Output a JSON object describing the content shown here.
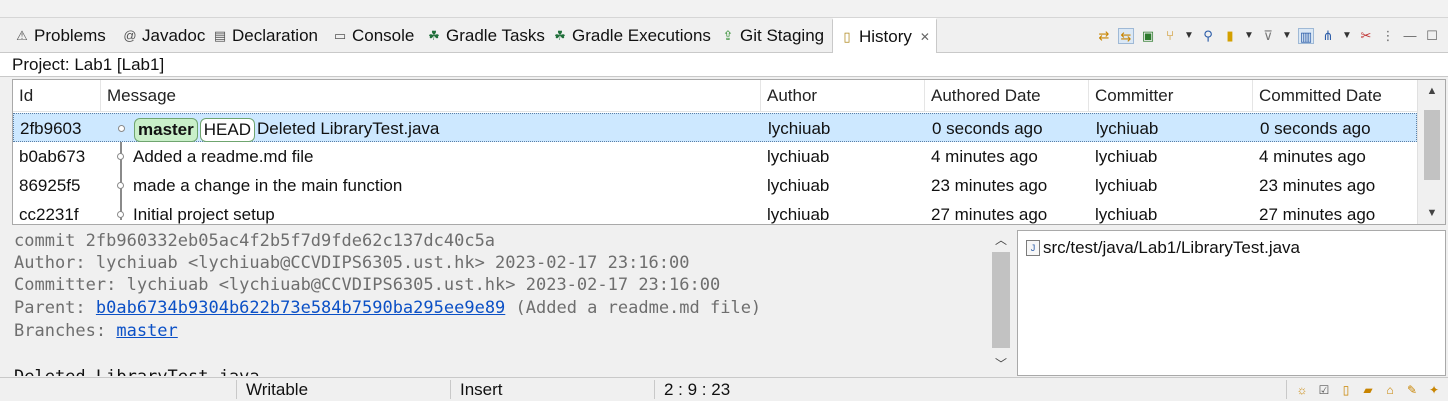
{
  "tabs": [
    {
      "label": "Problems",
      "icon": "problems-icon",
      "glyph": "⚠"
    },
    {
      "label": "Javadoc",
      "icon": "javadoc-icon",
      "glyph": "@"
    },
    {
      "label": "Declaration",
      "icon": "declaration-icon",
      "glyph": "▤"
    },
    {
      "label": "Console",
      "icon": "console-icon",
      "glyph": "▭"
    },
    {
      "label": "Gradle Tasks",
      "icon": "gradle-icon",
      "glyph": "☘"
    },
    {
      "label": "Gradle Executions",
      "icon": "gradle-icon",
      "glyph": "☘"
    },
    {
      "label": "Git Staging",
      "icon": "git-staging-icon",
      "glyph": "⇪"
    },
    {
      "label": "History",
      "icon": "history-icon",
      "glyph": "▯",
      "active": true,
      "close": "✕"
    }
  ],
  "project_line": "Project: Lab1 [Lab1]",
  "table": {
    "headers": [
      "Id",
      "Message",
      "Author",
      "Authored Date",
      "Committer",
      "Committed Date"
    ],
    "rows": [
      {
        "id": "2fb9603",
        "refs": [
          "master",
          "HEAD"
        ],
        "message": "Deleted LibraryTest.java",
        "author": "lychiuab",
        "authored": "0 seconds ago",
        "committer": "lychiuab",
        "committed": "0 seconds ago",
        "selected": true
      },
      {
        "id": "b0ab673",
        "refs": [],
        "message": "Added a readme.md file",
        "author": "lychiuab",
        "authored": "4 minutes ago",
        "committer": "lychiuab",
        "committed": "4 minutes ago"
      },
      {
        "id": "86925f5",
        "refs": [],
        "message": "made a change in the main function",
        "author": "lychiuab",
        "authored": "23 minutes ago",
        "committer": "lychiuab",
        "committed": "23 minutes ago"
      },
      {
        "id": "cc2231f",
        "refs": [],
        "message": "Initial project setup",
        "author": "lychiuab",
        "authored": "27 minutes ago",
        "committer": "lychiuab",
        "committed": "27 minutes ago"
      }
    ]
  },
  "details": {
    "commit_line": "commit 2fb960332eb05ac4f2b5f7d9fde62c137dc40c5a",
    "author_line": "Author: lychiuab <lychiuab@CCVDIPS6305.ust.hk> 2023-02-17 23:16:00",
    "committer_line": "Committer: lychiuab <lychiuab@CCVDIPS6305.ust.hk> 2023-02-17 23:16:00",
    "parent_prefix": "Parent: ",
    "parent_hash": "b0ab6734b9304b622b73e584b7590ba295ee9e89",
    "parent_suffix": " (Added a readme.md file)",
    "branches_prefix": "Branches: ",
    "branches_link": "master",
    "message": "Deleted LibraryTest.java"
  },
  "files": [
    "src/test/java/Lab1/LibraryTest.java"
  ],
  "status": {
    "writable": "Writable",
    "insert": "Insert",
    "position": "2 : 9 : 23"
  },
  "colors": {
    "selection": "#cde8ff",
    "ref_badge": "#c9efc9",
    "link": "#0b50c6"
  }
}
